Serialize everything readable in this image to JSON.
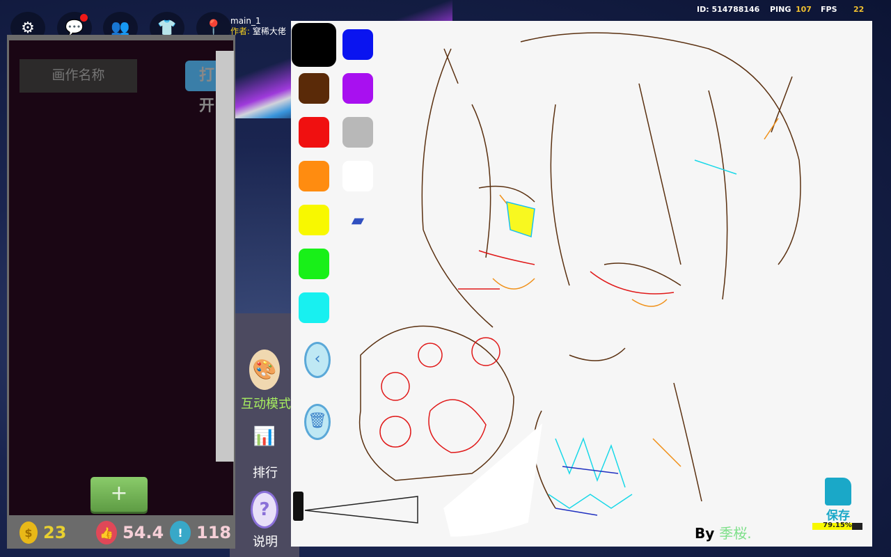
{
  "topbar": {
    "icons": [
      "gear-icon",
      "chat-icon",
      "friends-icon",
      "wardrobe-icon",
      "map-icon"
    ],
    "map_name": "main_1",
    "author_label": "作者:",
    "author_name": "窒稀大佬"
  },
  "hud": {
    "id": "ID: 514788146",
    "ping_label": "PING",
    "ping": "107",
    "fps_label": "FPS",
    "fps": "22"
  },
  "panel": {
    "name_placeholder": "画作名称",
    "open_label": "打开",
    "add_label": "+"
  },
  "stats": {
    "coins": "23",
    "likes": "54.4",
    "reports": "118"
  },
  "palette": {
    "colors": [
      "#000000",
      "#0a14f0",
      "#5a2a08",
      "#a810f0",
      "#f01010",
      "#b8b8b8",
      "#ff8c10",
      "#ffffff",
      "#f8f800",
      "#18f018",
      "#18f0f0"
    ],
    "selected": "#000000"
  },
  "side": {
    "interactive_label": "互动模式",
    "rank_label": "排行",
    "help_label": "说明"
  },
  "canvas": {
    "by_label": "By",
    "artist": "季桜.",
    "save_label": "保存",
    "upload_progress": "79.15%",
    "progress_fraction": 0.7915
  }
}
